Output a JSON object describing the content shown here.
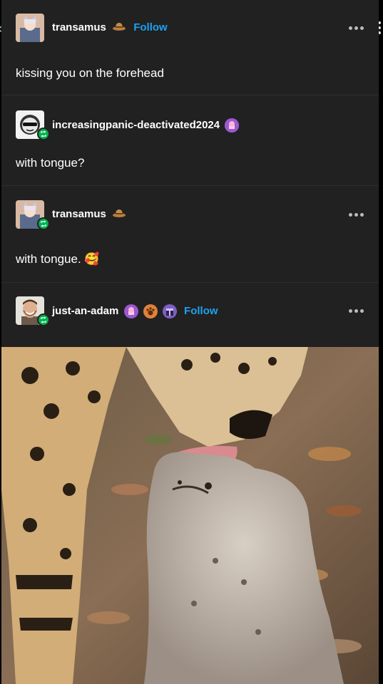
{
  "thread": [
    {
      "username": "transamus",
      "follow_label": "Follow",
      "text": "kissing you on the forehead",
      "avatar": "anime-character-avatar",
      "hat": "hat-emoji"
    },
    {
      "username": "increasingpanic-deactivated2024",
      "text": "with tongue?",
      "avatar": "sunglasses-face-avatar",
      "badges": [
        "purple-cupcake-badge"
      ]
    },
    {
      "username": "transamus",
      "text": "with tongue. 🥰",
      "avatar": "anime-character-avatar",
      "hat": "hat-emoji"
    },
    {
      "username": "just-an-adam",
      "follow_label": "Follow",
      "avatar": "smiling-man-avatar",
      "badges": [
        "purple-cupcake-badge",
        "orange-paw-badge",
        "purple-gift-badge"
      ]
    }
  ],
  "image": {
    "description_name": "cheetah-licking-cub-photo"
  },
  "colors": {
    "background": "#212121",
    "follow_blue": "#1ea1f2",
    "reblog_green": "#00b04f"
  }
}
